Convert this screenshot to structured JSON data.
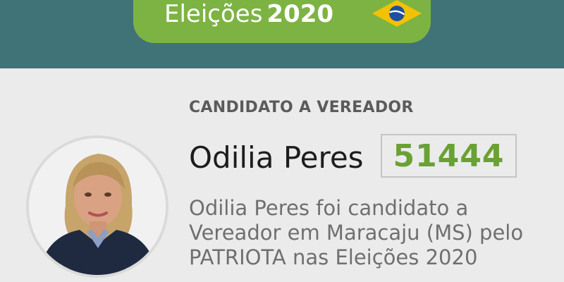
{
  "header": {
    "election_word": "Eleições",
    "election_year": "2020",
    "flag_icon": "brazil-flag-icon",
    "colors": {
      "bar": "#3f7377",
      "pill": "#7db343"
    }
  },
  "candidate": {
    "role": "CANDIDATO A VEREADOR",
    "name": "Odilia Peres",
    "number": "51444",
    "number_color": "#6aa133",
    "description_lines": [
      "Odilia Peres foi candidato a",
      "Vereador em Maracaju (MS) pelo",
      "PATRIOTA nas Eleições 2020"
    ]
  }
}
